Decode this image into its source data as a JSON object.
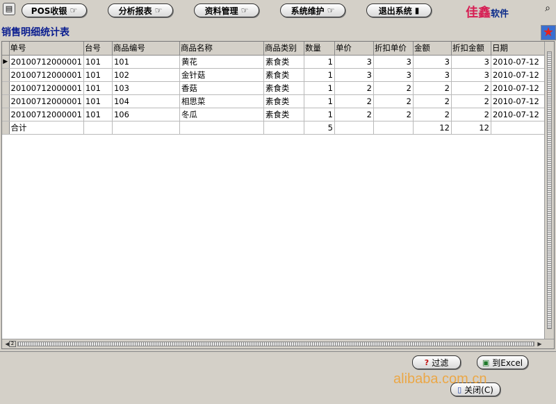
{
  "toolbar": {
    "buttons": [
      {
        "label": "POS收银",
        "icon": "hand-pointer-icon"
      },
      {
        "label": "分析报表",
        "icon": "hand-pointer-icon"
      },
      {
        "label": "资料管理",
        "icon": "hand-pointer-icon"
      },
      {
        "label": "系统维护",
        "icon": "hand-pointer-icon"
      },
      {
        "label": "退出系统",
        "icon": "exit-door-icon"
      }
    ],
    "brand": "佳鑫",
    "brand_suffix": "软件"
  },
  "page_title": "销售明细统计表",
  "grid": {
    "columns": [
      "单号",
      "台号",
      "商品编号",
      "商品名称",
      "商品类别",
      "数量",
      "单价",
      "折扣单价",
      "金额",
      "折扣金额",
      "日期"
    ],
    "rows": [
      [
        "20100712000001",
        "101",
        "101",
        "黄花",
        "素食类",
        "1",
        "3",
        "3",
        "3",
        "3",
        "2010-07-12"
      ],
      [
        "20100712000001",
        "101",
        "102",
        "金针菇",
        "素食类",
        "1",
        "3",
        "3",
        "3",
        "3",
        "2010-07-12"
      ],
      [
        "20100712000001",
        "101",
        "103",
        "香菇",
        "素食类",
        "1",
        "2",
        "2",
        "2",
        "2",
        "2010-07-12"
      ],
      [
        "20100712000001",
        "101",
        "104",
        "相思菜",
        "素食类",
        "1",
        "2",
        "2",
        "2",
        "2",
        "2010-07-12"
      ],
      [
        "20100712000001",
        "101",
        "106",
        "冬瓜",
        "素食类",
        "1",
        "2",
        "2",
        "2",
        "2",
        "2010-07-12"
      ]
    ],
    "total_row": [
      "合计",
      "",
      "",
      "",
      "",
      "5",
      "",
      "",
      "12",
      "12",
      ""
    ]
  },
  "bottom": {
    "filter_label": "过滤",
    "export_label": "到Excel",
    "close_label": "关闭(C)"
  },
  "watermark": "alibaba.com.cn",
  "colors": {
    "title": "#0a1d8f",
    "brand": "#d61f54",
    "background": "#d4d0c8",
    "watermark": "#f0a030"
  }
}
